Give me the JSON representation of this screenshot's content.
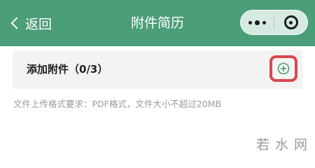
{
  "navbar": {
    "back_label": "返回",
    "title": "附件简历",
    "background_color": "#4b9e78",
    "capsule": {
      "more_icon": "more-dots-icon",
      "close_icon": "target-close-icon"
    }
  },
  "attachment_row": {
    "label": "添加附件（0/3）",
    "add_icon": "plus-circle-icon",
    "add_icon_color": "#4b9e78",
    "highlight_color": "#d9474e"
  },
  "hint": {
    "text": "文件上传格式要求：PDF格式，文件大小不超过20MB"
  },
  "watermark": {
    "text": "若水网"
  }
}
